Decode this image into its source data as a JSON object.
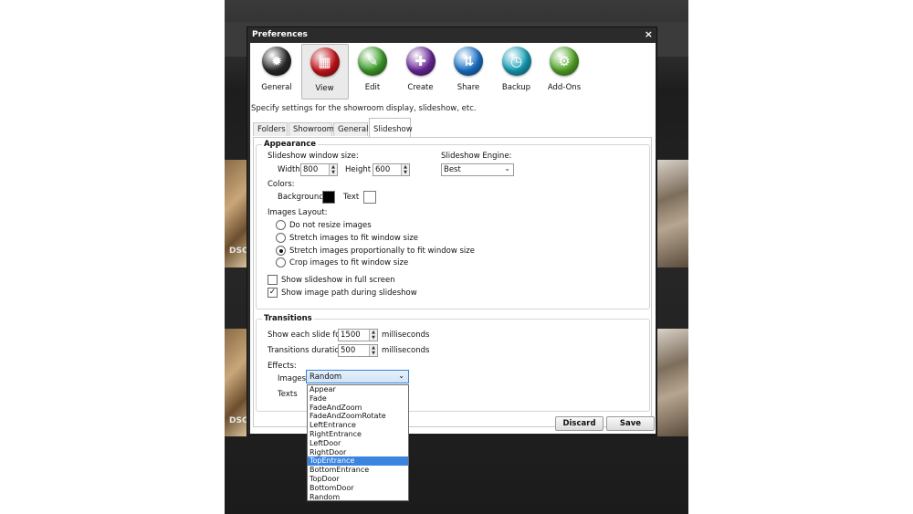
{
  "dialog": {
    "title": "Preferences",
    "close": "×"
  },
  "toolbar": [
    {
      "label": "General",
      "icon": "general-gear-icon",
      "color": "#2a2a2a",
      "glyph": "✹"
    },
    {
      "label": "View",
      "icon": "view-filmstrip-icon",
      "color": "#c8141a",
      "glyph": "▦"
    },
    {
      "label": "Edit",
      "icon": "edit-pen-icon",
      "color": "#3f9e2a",
      "glyph": "✎"
    },
    {
      "label": "Create",
      "icon": "create-document-icon",
      "color": "#6a2a9a",
      "glyph": "✚"
    },
    {
      "label": "Share",
      "icon": "share-arrows-icon",
      "color": "#1d74c8",
      "glyph": "⇅"
    },
    {
      "label": "Backup",
      "icon": "backup-clock-icon",
      "color": "#17a0b8",
      "glyph": "◷"
    },
    {
      "label": "Add-Ons",
      "icon": "addons-gears-icon",
      "color": "#56a82a",
      "glyph": "⚙"
    }
  ],
  "hint": "Specify settings for the showroom display, slideshow, etc.",
  "tabs": [
    "Folders",
    "Showroom",
    "General",
    "Slideshow"
  ],
  "appearance": {
    "title": "Appearance",
    "window_size_label": "Slideshow window size:",
    "width_label": "Width",
    "width_value": "800",
    "height_label": "Height",
    "height_value": "600",
    "engine_label": "Slideshow Engine:",
    "engine_value": "Best",
    "colors_label": "Colors:",
    "background_label": "Background",
    "background_color": "#000000",
    "text_label": "Text",
    "text_color": "#ffffff",
    "layout_label": "Images Layout:",
    "layout_options": [
      "Do not resize images",
      "Stretch images to fit window size",
      "Stretch images  proportionally to fit window size",
      "Crop images to fit window size"
    ],
    "layout_selected": 2,
    "fullscreen_label": "Show slideshow in full screen",
    "fullscreen_checked": false,
    "show_path_label": "Show image path during slideshow",
    "show_path_checked": true
  },
  "transitions": {
    "title": "Transitions",
    "show_each_label": "Show each slide for",
    "show_each_value": "1500",
    "ms_label": "milliseconds",
    "duration_label": "Transitions duration:",
    "duration_value": "500",
    "effects_label": "Effects:",
    "images_label": "Images",
    "images_value": "Random",
    "texts_label": "Texts"
  },
  "dropdown": {
    "options": [
      "Appear",
      "Fade",
      "FadeAndZoom",
      "FadeAndZoomRotate",
      "LeftEntrance",
      "RightEntrance",
      "LeftDoor",
      "RightDoor",
      "TopEntrance",
      "BottomEntrance",
      "TopDoor",
      "BottomDoor",
      "Random"
    ],
    "highlighted": 8
  },
  "buttons": {
    "discard": "Discard",
    "save": "Save"
  },
  "background_app": {
    "label_left_top": "DSC",
    "label_left_bottom": "DSC"
  }
}
